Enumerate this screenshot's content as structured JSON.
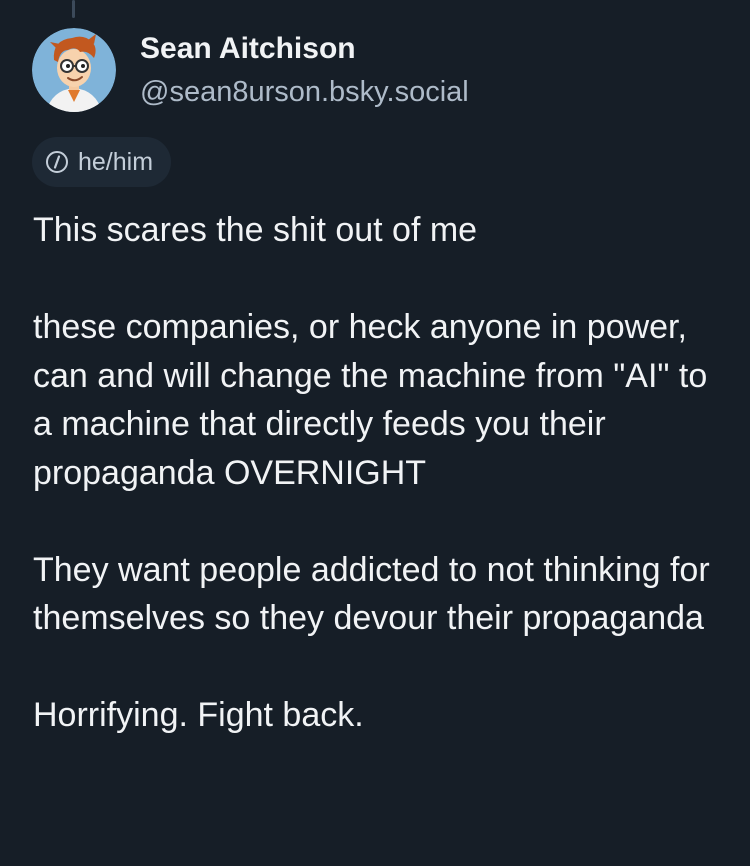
{
  "author": {
    "display_name": "Sean Aitchison",
    "handle": "@sean8urson.bsky.social",
    "avatar_icon": "cartoon-avatar"
  },
  "pronouns": {
    "icon": "info-icon",
    "label": "he/him"
  },
  "post": {
    "paragraphs": [
      "This scares the shit out of me",
      "these companies, or heck anyone in power, can and will change the machine from \"AI\" to a machine that directly feeds you their propaganda OVERNIGHT",
      "They want people addicted to not thinking for themselves so they devour their propaganda",
      "Horrifying. Fight back."
    ]
  },
  "colors": {
    "background": "#161e27",
    "text_primary": "#f1f3f5",
    "text_secondary": "#aebbc9",
    "pill_background": "#1e2935",
    "avatar_background": "#7fb3d9"
  }
}
